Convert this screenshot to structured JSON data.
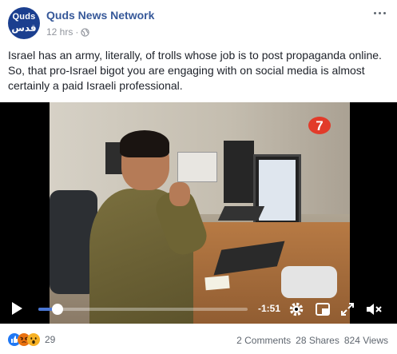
{
  "page": {
    "name": "Quds News Network",
    "logo_text_top": "Quds",
    "logo_text_bottom": "قدس",
    "timestamp": "12 hrs",
    "separator": "·",
    "privacy_icon": "globe-icon",
    "more_icon": "more-options-icon"
  },
  "post": {
    "text": "Israel has an army, literally, of trolls whose job is to post propaganda online. So, that pro-Israel bigot you are engaging with on social media is almost certainly a paid Israeli professional."
  },
  "video": {
    "channel_badge": "7",
    "time_remaining": "-1:51",
    "progress": 0.09,
    "play_icon": "play-icon",
    "settings_icon": "gear-icon",
    "pip_icon": "picture-in-picture-icon",
    "fullscreen_icon": "fullscreen-icon",
    "mute_icon": "speaker-muted-icon"
  },
  "engagement": {
    "reactions": [
      "like",
      "angry",
      "wow"
    ],
    "reaction_count": "29",
    "comments": "2 Comments",
    "shares": "28 Shares",
    "views": "824 Views"
  },
  "colors": {
    "link": "#365899",
    "meta": "#90949c",
    "accent": "#4a76d3",
    "like": "#2078f4",
    "angry": "#e9710f",
    "wow": "#f7b125"
  }
}
